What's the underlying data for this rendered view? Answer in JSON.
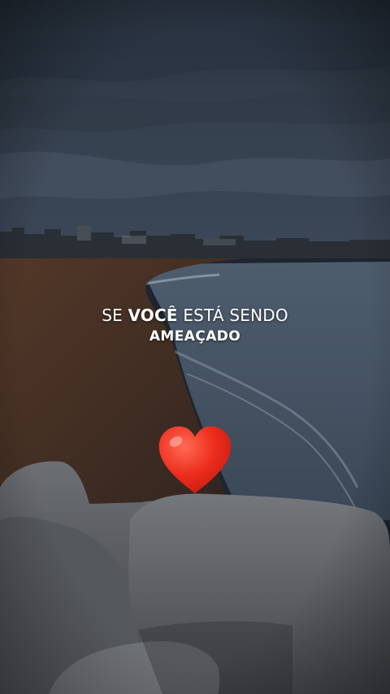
{
  "caption": {
    "line1_prefix": "SE ",
    "line1_bold": "VOCÊ",
    "line1_suffix": " ESTÁ SENDO",
    "line2": "AMEAÇADO"
  },
  "sticker": {
    "icon": "red-heart-emoji",
    "color": "#e8261b"
  },
  "scene": {
    "description_colors": {
      "sky": "#2f3a49",
      "sand": "#4a3326",
      "sea": "#4b5a6b",
      "rocks": "#5a5d62"
    }
  }
}
